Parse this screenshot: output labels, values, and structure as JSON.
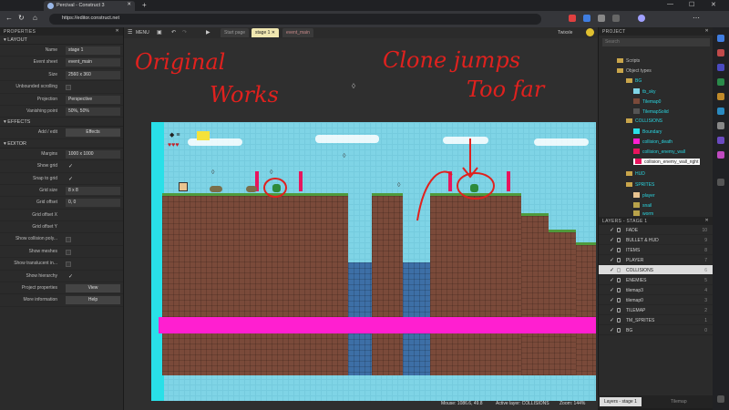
{
  "browser": {
    "tab_title": "Percival - Construct 3",
    "url": "https://editor.construct.net",
    "new_tab_label": "+",
    "close_label": "✕"
  },
  "app": {
    "menu_label": "MENU",
    "layout_tabs": [
      "Start page",
      "stage 1",
      "event_main"
    ],
    "user": "Twixxle"
  },
  "properties": {
    "header": "PROPERTIES",
    "sections": {
      "layout": "LAYOUT",
      "effects": "EFFECTS",
      "editor": "EDITOR"
    },
    "layout_rows": [
      {
        "label": "Name",
        "value": "stage 1"
      },
      {
        "label": "Event sheet",
        "value": "event_main"
      },
      {
        "label": "Size",
        "value": "2560 x 360"
      },
      {
        "label": "Unbounded scrolling",
        "value": ""
      },
      {
        "label": "Projection",
        "value": "Perspective"
      },
      {
        "label": "Vanishing point",
        "value": "50%, 50%"
      }
    ],
    "effects_row": {
      "label": "Add / edit",
      "value": "Effects"
    },
    "editor_rows": [
      {
        "label": "Margins",
        "value": "1000 x 1000"
      },
      {
        "label": "Show grid",
        "value": "✓"
      },
      {
        "label": "Snap to grid",
        "value": "✓"
      },
      {
        "label": "Grid size",
        "value": "8 x 8"
      },
      {
        "label": "Grid offset",
        "value": "0, 0"
      },
      {
        "label": "Grid offset X",
        "value": ""
      },
      {
        "label": "Grid offset Y",
        "value": ""
      },
      {
        "label": "Show collision poly...",
        "value": ""
      },
      {
        "label": "Show meshes",
        "value": ""
      },
      {
        "label": "Show translucent in...",
        "value": ""
      },
      {
        "label": "Show hierarchy",
        "value": "✓"
      },
      {
        "label": "Project properties",
        "value": "View"
      },
      {
        "label": "More information",
        "value": "Help"
      }
    ]
  },
  "project": {
    "header": "PROJECT",
    "search_placeholder": "Search",
    "items": [
      "Scripts",
      "Object types",
      "BG",
      "tb_sky",
      "Tilemap0",
      "TilemapSolid",
      "COLLISIONS",
      "Boundary",
      "collision_death",
      "collision_enemy_wall",
      "collision_enemy_wall_right",
      "HUD",
      "SPRITES",
      "player",
      "snail",
      "worm"
    ]
  },
  "layers": {
    "header": "LAYERS - STAGE 1",
    "rows": [
      {
        "name": "FADE",
        "num": "10"
      },
      {
        "name": "BULLET & HUD",
        "num": "9"
      },
      {
        "name": "ITEMS",
        "num": "8"
      },
      {
        "name": "PLAYER",
        "num": "7"
      },
      {
        "name": "COLLISIONS",
        "num": "6"
      },
      {
        "name": "ENEMIES",
        "num": "5"
      },
      {
        "name": "tilemap3",
        "num": "4"
      },
      {
        "name": "tilemap0",
        "num": "3"
      },
      {
        "name": "TILEMAP",
        "num": "2"
      },
      {
        "name": "TM_SPRITES",
        "num": "1"
      },
      {
        "name": "BG",
        "num": "0"
      }
    ],
    "bottom_tabs": [
      "Layers - stage 1",
      "Tilemap"
    ]
  },
  "status": {
    "mouse": "Mouse: 1086.6, 49.8",
    "active_layer": "Active layer: COLLISIONS",
    "zoom": "Zoom: 144%"
  },
  "annotations": {
    "left_line1": "Original",
    "left_line2": "Works",
    "right_line1": "Clone jumps",
    "right_line2": "Too far"
  },
  "colors": {
    "accent": "#7fd4e6",
    "annotation": "#e0211e",
    "pink_collision": "#ff1fd0"
  }
}
